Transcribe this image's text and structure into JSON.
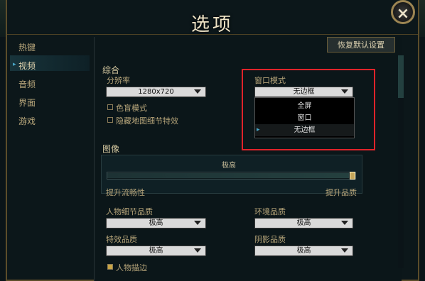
{
  "window": {
    "title": "选项",
    "close_label": "×"
  },
  "sidebar": {
    "items": [
      {
        "label": "热键"
      },
      {
        "label": "视频",
        "active": true
      },
      {
        "label": "音频"
      },
      {
        "label": "界面"
      },
      {
        "label": "游戏"
      }
    ]
  },
  "toolbar": {
    "reset_label": "恢复默认设置"
  },
  "general": {
    "section_title": "综合",
    "resolution_label": "分辨率",
    "resolution_value": "1280x720",
    "colorblind_label": "色盲模式",
    "hide_terrain_label": "隐藏地图细节特效",
    "window_mode_label": "窗口模式",
    "window_mode_value": "无边框",
    "window_mode_options": [
      "全屏",
      "窗口",
      "无边框"
    ]
  },
  "graphics": {
    "section_title": "图像",
    "quality_value": "极高",
    "left_caption": "提升流畅性",
    "right_caption": "提升品质",
    "character_quality_label": "人物细节品质",
    "character_quality_value": "极高",
    "environment_quality_label": "环境品质",
    "environment_quality_value": "极高",
    "effects_quality_label": "特效品质",
    "effects_quality_value": "极高",
    "shadow_quality_label": "阴影品质",
    "shadow_quality_value": "极高",
    "character_outline_label": "人物描边",
    "slider_level_percent": 100
  },
  "colors": {
    "highlight_box": "#e0232a",
    "accent_gold": "#c4a559",
    "active_marker": "#4aa9c9"
  }
}
